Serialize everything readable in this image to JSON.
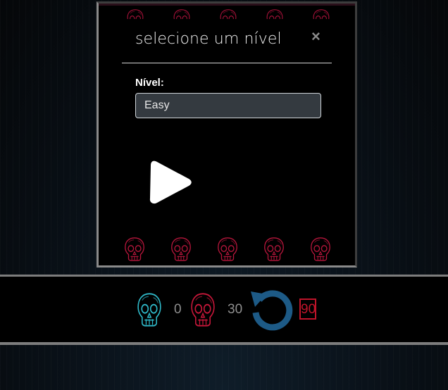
{
  "modal": {
    "title": "selecione um nível",
    "close_label": "×",
    "field_label": "Nível:",
    "level_value": "Easy"
  },
  "hud": {
    "player_score": "0",
    "enemy_score": "30",
    "timer": "90"
  },
  "icons": {
    "close": "close-icon",
    "play": "play-icon",
    "restart": "restart-icon",
    "player": "cyan-skull-icon",
    "enemy": "red-skull-icon"
  },
  "colors": {
    "player": "#2fb9c9",
    "enemy": "#c8173a",
    "restart": "#1d5a86",
    "timer": "#c0142a"
  }
}
